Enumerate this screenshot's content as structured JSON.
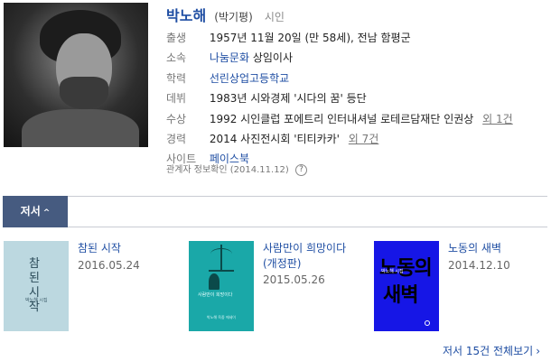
{
  "profile": {
    "name": "박노해",
    "hanja_name": "(박기평)",
    "occupation": "시인",
    "photo_icon": "portrait-photo"
  },
  "info": {
    "birth": {
      "label": "출생",
      "value": "1957년 11월 20일 (만 58세), 전남 함평군"
    },
    "affiliation": {
      "label": "소속",
      "link": "나눔문화",
      "value": "상임이사"
    },
    "education": {
      "label": "학력",
      "link": "선린상업고등학교"
    },
    "debut": {
      "label": "데뷔",
      "value": "1983년 시와경제 '시다의 꿈' 등단"
    },
    "awards": {
      "label": "수상",
      "value": "1992 시인클럽 포에트리 인터내셔널 로테르담재단 인권상",
      "more": "외 1건"
    },
    "career": {
      "label": "경력",
      "value": "2014 사진전시회 '티티카카'",
      "more": "외 7건"
    },
    "site": {
      "label": "사이트",
      "link": "페이스북"
    }
  },
  "meta": {
    "text": "관계자 정보확인 (2014.11.12)",
    "help_icon": "?"
  },
  "tabs": {
    "active_label": "저서",
    "caret": "^"
  },
  "books": [
    {
      "title": "참된 시작",
      "date": "2016.05.24",
      "cover_text": "참된 시작",
      "cover_sub": "박노해 시집",
      "cover_color": "#bcd8e0"
    },
    {
      "title_line1": "사람만이 희망이다",
      "title_line2": "(개정판)",
      "date": "2015.05.26",
      "cover_text": "사람만이 희망이다",
      "cover_sub": "박노해 옥중 에세이",
      "cover_color": "#1aa8a8"
    },
    {
      "title": "노동의 새벽",
      "date": "2014.12.10",
      "cover_text1": "노동의",
      "cover_text2": "새벽",
      "cover_sub": "박노해 시집",
      "cover_color": "#1616e6"
    }
  ],
  "footer": {
    "all_books": "저서 15건 전체보기",
    "chevron": "›"
  },
  "colors": {
    "link": "#1f4ea3",
    "tab_active": "#465b80"
  }
}
